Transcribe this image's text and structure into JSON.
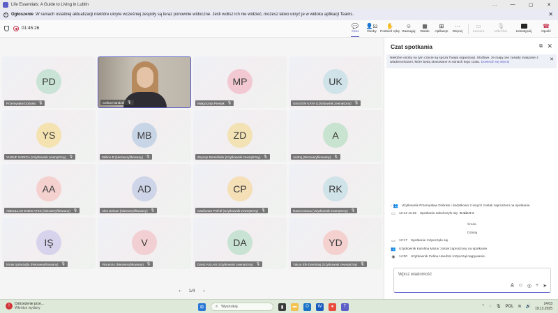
{
  "window": {
    "title": "Life Essentials: A Guide to Living in Lublin",
    "controls": [
      "…",
      "—",
      "▢",
      "✕"
    ]
  },
  "banner": {
    "heading": "Ogłoszenie",
    "text": "W ramach ostatniej aktualizacji niektóre ukryte wcześniej zespoły są teraz ponownie widoczne. Jeśli wolisz ich nie widzieć, możesz łatwo ukryć je w widoku aplikacji Teams."
  },
  "meeting": {
    "timer": "01:45:26",
    "toolbar": {
      "chat": "Czat",
      "people": "Osoby",
      "people_count": "52",
      "raise": "Podnieś rękę",
      "react": "Zareaguj",
      "view": "Widok",
      "apps": "Aplikacje",
      "more": "Więcej",
      "camera": "Kamera",
      "mic": "Mikrofon",
      "share": "Udostępnij",
      "leave": "Opuść"
    },
    "participants": [
      {
        "initials": "PD",
        "name": "Przemysław Dobrało",
        "color": "#c9e3d6"
      },
      {
        "initials": "",
        "name": "Celina Handzel",
        "color": "",
        "video": true
      },
      {
        "initials": "MP",
        "name": "Małgorzata Piesiak",
        "color": "#f2c9d2"
      },
      {
        "initials": "UK",
        "name": "Umut Efe KAYA (Użytkownik zewnętrzny)",
        "color": "#cfe3e8"
      },
      {
        "initials": "YS",
        "name": "YUSUF SARICA (Użytkownik zewnętrzny)",
        "color": "#f4e3b0"
      },
      {
        "initials": "MB",
        "name": "Méline B (Niezweryfikowany)",
        "color": "#c8d5e6"
      },
      {
        "initials": "ZD",
        "name": "Zeynep Demirbilek (Użytkownik zewnętrzny)",
        "color": "#f2e2b4"
      },
      {
        "initials": "A",
        "name": "Andrej (Niezweryfikowany)",
        "color": "#c8e3cf"
      },
      {
        "initials": "AA",
        "name": "ABDULLAH ENES ATES (Niezweryfikowany)",
        "color": "#f4d0cf"
      },
      {
        "initials": "AD",
        "name": "Alex Delcan (Niezweryfikowany)",
        "color": "#cfd5e8"
      },
      {
        "initials": "CP",
        "name": "Своболан Рябчй (Użytkownik zewnętrzny)",
        "color": "#f4dfb6"
      },
      {
        "initials": "RK",
        "name": "Rana Karaca (Użytkownik zewnętrzny)",
        "color": "#cfe3e8"
      },
      {
        "initials": "IŞ",
        "name": "İrmak Şahutoğlu (Niezweryfikowany)",
        "color": "#d7d3ec"
      },
      {
        "initials": "V",
        "name": "Vincenzo (Niezweryfikowany)",
        "color": "#f1cfd2"
      },
      {
        "initials": "DA",
        "name": "Deniz ASLAN (Użytkownik zewnętrzny)",
        "color": "#c8e3d3"
      },
      {
        "initials": "YD",
        "name": "Yalçın Efe Demirtaş (Użytkownik zewnętrzny)",
        "color": "#f4d0cf"
      }
    ],
    "pager": {
      "prev": "‹",
      "label": "1/4",
      "next": "›"
    }
  },
  "chat": {
    "title": "Czat spotkania",
    "notice_text": "Niektóre osoby na tym czacie są spoza Twojej organizacji. Możliwe, że mają one zasady związane z wiadomościami, które będą stosowane w ramach tego czatu.",
    "notice_link": "Dowiedz się więcej",
    "events": [
      {
        "icon": "👥",
        "time": "",
        "text": "Użytkownik Przemysław Dobrało i dodatkowo 2 innych zostali zaproszeni na spotkanie.",
        "bold": "",
        "prefix": "›"
      },
      {
        "icon": "▭",
        "time": "12:12 11:39",
        "text": "Spotkanie zakończyło się:",
        "bold": "5 min 5 s"
      },
      {
        "icon": "",
        "time": "",
        "text": "Środa",
        "center": true
      },
      {
        "icon": "",
        "time": "",
        "text": "Dzisiaj",
        "center": true
      },
      {
        "icon": "▭",
        "time": "12:17",
        "text": "Spotkanie rozpoczęło się",
        "bold": ""
      },
      {
        "icon": "👥",
        "time": "",
        "text": "Użytkownik Karolina Mazur został zaproszony na spotkanie.",
        "bold": ""
      },
      {
        "icon": "◉",
        "time": "14:00",
        "text": "Użytkownik Celina Handzel rozpoczął nagrywanie.",
        "bold": ""
      }
    ],
    "compose_placeholder": "Wpisz wiadomość"
  },
  "taskbar": {
    "weather_title": "Ostrzeżenie prze...",
    "weather_sub": "Wkrótce wydany",
    "search": "Wyszukaj",
    "lang": "POL",
    "time": "14:03",
    "date": "19.12.2025"
  }
}
